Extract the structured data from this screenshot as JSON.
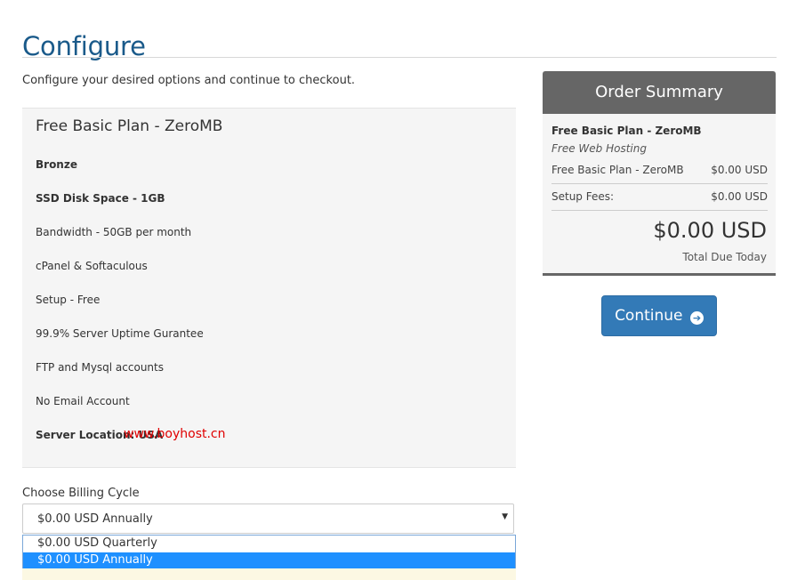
{
  "page": {
    "title": "Configure",
    "intro": "Configure your desired options and continue to checkout."
  },
  "product": {
    "name": "Free Basic Plan - ZeroMB",
    "features": [
      {
        "text": "Bronze",
        "bold": true
      },
      {
        "text": "SSD Disk Space - 1GB",
        "bold": true
      },
      {
        "text": "Bandwidth - 50GB per month",
        "bold": false
      },
      {
        "text": "cPanel & Softaculous",
        "bold": false
      },
      {
        "text": "Setup - Free",
        "bold": false
      },
      {
        "text": "99.9% Server Uptime Gurantee",
        "bold": false
      },
      {
        "text": "FTP and Mysql accounts",
        "bold": false
      },
      {
        "text": "No Email Account",
        "bold": false
      },
      {
        "text": "Server Location: USA",
        "bold": true
      }
    ]
  },
  "watermark": "www.boyhost.cn",
  "billing": {
    "label": "Choose Billing Cycle",
    "selected": "$0.00 USD Annually",
    "options": [
      "$0.00 USD Quarterly",
      "$0.00 USD Annually"
    ],
    "highlighted_index": 1
  },
  "summary": {
    "heading": "Order Summary",
    "product": "Free Basic Plan - ZeroMB",
    "group": "Free Web Hosting",
    "line_item_label": "Free Basic Plan - ZeroMB",
    "line_item_price": "$0.00 USD",
    "setup_label": "Setup Fees:",
    "setup_price": "$0.00 USD",
    "total": "$0.00 USD",
    "total_label": "Total Due Today"
  },
  "continue_label": "Continue",
  "colors": {
    "title": "#1a5a8a",
    "button": "#337ab7",
    "summary_header": "#666666",
    "dropdown_highlight": "#1e90ff"
  },
  "icons": {
    "continue": "arrow-circle-right-icon",
    "select": "caret-down-icon"
  }
}
